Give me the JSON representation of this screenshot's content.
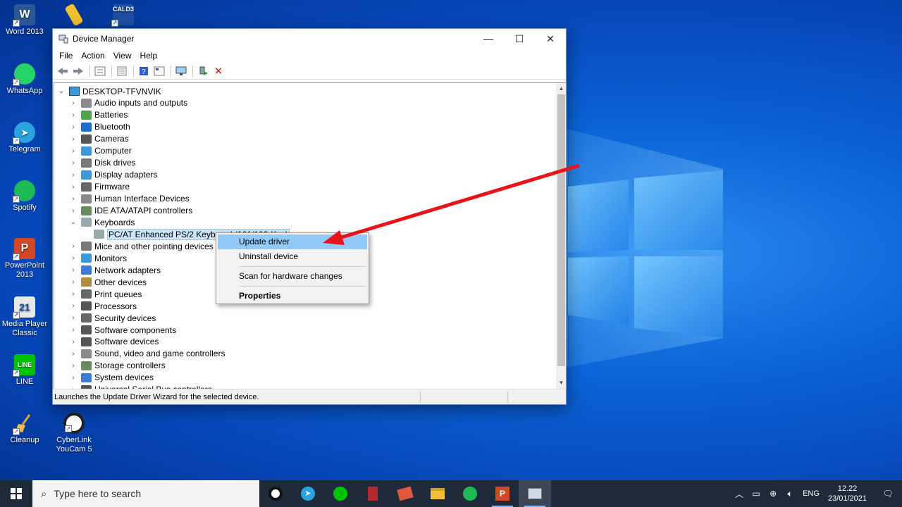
{
  "desktop": {
    "icons": [
      {
        "label": "Word 2013",
        "name": "word-2013",
        "color": "#2b5797"
      },
      {
        "label": "",
        "name": "shortcut-tool",
        "color": "#f2c12e"
      },
      {
        "label": "",
        "name": "cald3",
        "color": "#1e4fa3",
        "text": "CALD3"
      },
      {
        "label": "WhatsApp",
        "name": "whatsapp",
        "color": "#25d366"
      },
      {
        "label": "Telegram",
        "name": "telegram",
        "color": "#2aa3de"
      },
      {
        "label": "Spotify",
        "name": "spotify",
        "color": "#1db954"
      },
      {
        "label": "PowerPoint 2013",
        "name": "powerpoint-2013",
        "color": "#d24726"
      },
      {
        "label": "Media Player Classic",
        "name": "media-player-classic",
        "color": "#e8e8e8"
      },
      {
        "label": "LINE",
        "name": "line",
        "color": "#00c300"
      },
      {
        "label": "Cleanup",
        "name": "cleanup",
        "color": "#e3a93b"
      },
      {
        "label": "CyberLink YouCam 5",
        "name": "cyberlink-youcam",
        "color": "#222222"
      }
    ]
  },
  "window": {
    "title": "Device Manager",
    "controls": {
      "minimize": "—",
      "maximize": "☐",
      "close": "✕"
    },
    "menu": [
      "File",
      "Action",
      "View",
      "Help"
    ],
    "toolbar": [
      "back-icon",
      "forward-icon",
      "tree-icon",
      "properties-icon",
      "help-icon",
      "view-icon",
      "monitor-icon",
      "update-driver-icon",
      "uninstall-icon"
    ],
    "tree": {
      "root": "DESKTOP-TFVNVIK",
      "categories": [
        {
          "label": "Audio inputs and outputs",
          "icon": "speaker-icon"
        },
        {
          "label": "Batteries",
          "icon": "battery-icon"
        },
        {
          "label": "Bluetooth",
          "icon": "bluetooth-icon"
        },
        {
          "label": "Cameras",
          "icon": "camera-icon"
        },
        {
          "label": "Computer",
          "icon": "computer-icon"
        },
        {
          "label": "Disk drives",
          "icon": "disk-icon"
        },
        {
          "label": "Display adapters",
          "icon": "display-icon"
        },
        {
          "label": "Firmware",
          "icon": "firmware-icon"
        },
        {
          "label": "Human Interface Devices",
          "icon": "hid-icon"
        },
        {
          "label": "IDE ATA/ATAPI controllers",
          "icon": "ide-icon"
        },
        {
          "label": "Keyboards",
          "icon": "keyboard-icon",
          "expanded": true
        },
        {
          "label": "PC/AT Enhanced PS/2 Keyboard (101/102-Key)",
          "icon": "keyboard-icon",
          "child": true,
          "selected": true
        },
        {
          "label": "Mice and other pointing devices",
          "icon": "mouse-icon"
        },
        {
          "label": "Monitors",
          "icon": "monitor-icon"
        },
        {
          "label": "Network adapters",
          "icon": "network-icon"
        },
        {
          "label": "Other devices",
          "icon": "other-icon"
        },
        {
          "label": "Print queues",
          "icon": "printer-icon"
        },
        {
          "label": "Processors",
          "icon": "processor-icon"
        },
        {
          "label": "Security devices",
          "icon": "security-icon"
        },
        {
          "label": "Software components",
          "icon": "software-icon"
        },
        {
          "label": "Software devices",
          "icon": "software-icon"
        },
        {
          "label": "Sound, video and game controllers",
          "icon": "speaker-icon"
        },
        {
          "label": "Storage controllers",
          "icon": "storage-icon"
        },
        {
          "label": "System devices",
          "icon": "system-icon"
        },
        {
          "label": "Universal Serial Bus controllers",
          "icon": "usb-icon"
        }
      ]
    },
    "context_menu": {
      "items": [
        "Update driver",
        "Uninstall device",
        "Scan for hardware changes",
        "Properties"
      ]
    },
    "status": "Launches the Update Driver Wizard for the selected device."
  },
  "taskbar": {
    "search_placeholder": "Type here to search",
    "apps": [
      "cyberlink-youcam",
      "telegram",
      "line",
      "book-app",
      "recipe-app",
      "file-explorer",
      "spotify",
      "powerpoint",
      "device-manager"
    ],
    "tray": {
      "lang": "ENG",
      "time": "12.22",
      "date": "23/01/2021"
    }
  }
}
